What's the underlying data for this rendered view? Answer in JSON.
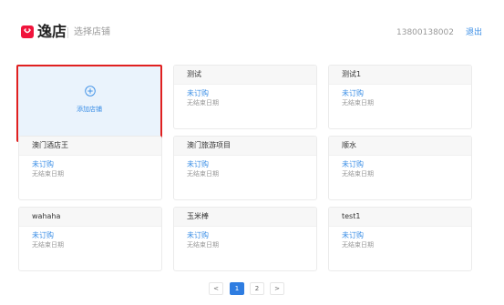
{
  "header": {
    "brand": "逸店",
    "title": "选择店铺",
    "phone": "13800138002",
    "logout": "退出"
  },
  "add_card": {
    "label": "添加店铺"
  },
  "stores": [
    {
      "name": "测试",
      "status": "未订购",
      "date": "无结束日期"
    },
    {
      "name": "测试1",
      "status": "未订购",
      "date": "无结束日期"
    },
    {
      "name": "澳门酒店王",
      "status": "未订购",
      "date": "无结束日期"
    },
    {
      "name": "澳门旅游项目",
      "status": "未订购",
      "date": "无结束日期"
    },
    {
      "name": "顺水",
      "status": "未订购",
      "date": "无结束日期"
    },
    {
      "name": "wahaha",
      "status": "未订购",
      "date": "无结束日期"
    },
    {
      "name": "玉米棒",
      "status": "未订购",
      "date": "无结束日期"
    },
    {
      "name": "test1",
      "status": "未订购",
      "date": "无结束日期"
    }
  ],
  "pagination": {
    "prev": "<",
    "pages": [
      "1",
      "2"
    ],
    "current": "1",
    "next": ">"
  },
  "colors": {
    "brand": "#f0143c",
    "accent": "#3a8ee6",
    "highlight": "#e02020"
  }
}
